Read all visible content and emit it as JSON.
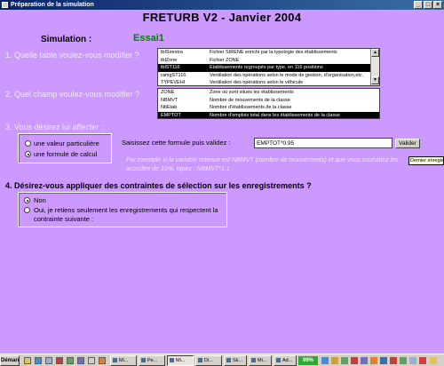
{
  "window": {
    "title": "Préparation de la simulation",
    "minimize": "_",
    "maximize": "□",
    "close": "×"
  },
  "app_title": "FRETURB V2 - Janvier 2004",
  "simulation": {
    "label": "Simulation :",
    "value": "Essai1"
  },
  "q1": {
    "label": "1. Quelle table voulez-vous modifier ?",
    "rows": [
      {
        "code": "tblSirextra",
        "desc": "Fichier SIRENE enrichi par la typologie des établissements",
        "selected": false
      },
      {
        "code": "tblZone",
        "desc": "Fichier ZONE",
        "selected": false
      },
      {
        "code": "tblST116",
        "desc": "Etablissements regroupés par type, en 116 positions",
        "selected": true
      },
      {
        "code": "ramgST116",
        "desc": "Ventilation des opérations selon le mode de gestion, d'organisation,etc.",
        "selected": false
      },
      {
        "code": "TYPEVEHI",
        "desc": "Ventilation des opérations selon le véhicule",
        "selected": false
      }
    ]
  },
  "q2": {
    "label": "2. Quel champ voulez-vous modifier ?",
    "rows": [
      {
        "code": "ZONE",
        "desc": "Zone où sont situés les établissements",
        "selected": false
      },
      {
        "code": "NBMVT",
        "desc": "Nombre de mouvements de la classe",
        "selected": false
      },
      {
        "code": "NbEtab",
        "desc": "Nombre d'établissements de la classe",
        "selected": false
      },
      {
        "code": "EMPTOT",
        "desc": "Nombre d'emplois total dans les établissements de la classe",
        "selected": true
      }
    ]
  },
  "q3": {
    "label": "3. Vous désirez lui affecter :",
    "options": [
      {
        "label": "une valeur particulière",
        "selected": false
      },
      {
        "label": "une formule de calcul",
        "selected": true
      }
    ],
    "formula_label": "Saisissez cette formule puis validez :",
    "formula_value": "EMPTOT*0.95",
    "validate_label": "Valider",
    "hint": "Par exemple si la variable retenue est NBMVT (nombre de mouvements) et que vous souhaitez les accroître de 10%, tapez : NBMVT*1.1",
    "tooltip": "Dernier enregistrement"
  },
  "q4": {
    "label": "4. Désirez-vous appliquer des contraintes de sélection sur les enregistrements ?",
    "options": [
      {
        "label": "Non",
        "selected": true
      },
      {
        "label": "Oui, je retiens seulement les enregistrements qui respectent la contrainte suivante :",
        "selected": false
      }
    ]
  },
  "taskbar": {
    "start": "Démarrer",
    "buttons": [
      "Mi...",
      "Pe...",
      "Mi...",
      "Di...",
      "Sk...",
      "Mi...",
      "Ad..."
    ],
    "active_index": 2,
    "battery": "99%"
  }
}
